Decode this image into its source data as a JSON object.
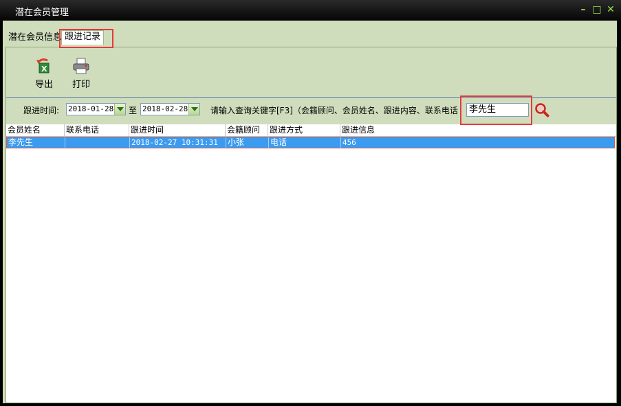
{
  "window": {
    "title": "潜在会员管理",
    "min_label": "–",
    "max_label": "□",
    "close_label": "✕"
  },
  "tabs": [
    {
      "label": "潜在会员信息",
      "active": false
    },
    {
      "label": "跟进记录",
      "active": true
    }
  ],
  "toolbar": {
    "export_label": "导出",
    "print_label": "打印",
    "export_icon": "excel-export-icon",
    "print_icon": "printer-icon"
  },
  "filter": {
    "date_label": "跟进时间:",
    "date_from": "2018-01-28",
    "to_label": "至",
    "date_to": "2018-02-28",
    "keyword_label": "请输入查询关键字[F3]（会籍顾问、会员姓名、跟进内容、联系电话",
    "keyword_value": "李先生",
    "search_icon": "magnifier-icon"
  },
  "table": {
    "columns": [
      "会员姓名",
      "联系电话",
      "跟进时间",
      "会籍顾问",
      "跟进方式",
      "跟进信息"
    ],
    "rows": [
      {
        "name": "李先生",
        "phone": "",
        "time": "2018-02-27 10:31:31",
        "advisor": "小张",
        "method": "电话",
        "info": "456"
      }
    ]
  },
  "colors": {
    "accent_green": "#9ee04a",
    "panel_bg": "#d0ddbd",
    "selection": "#3b9bf0",
    "highlight": "#e53a3a"
  }
}
